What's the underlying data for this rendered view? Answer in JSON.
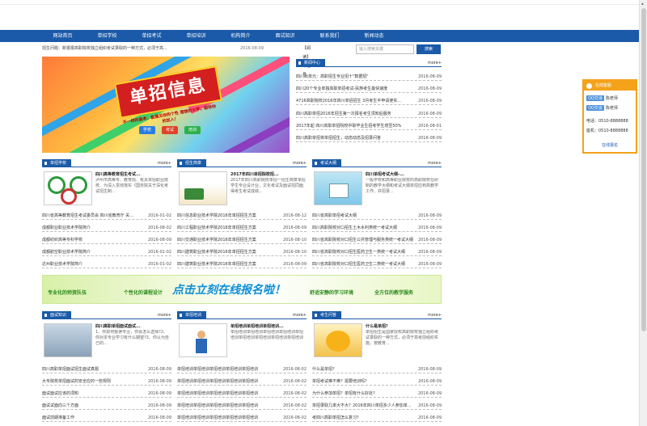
{
  "nav": [
    "网站首页",
    "单招学校",
    "单招考试",
    "单招培训",
    "机构简介",
    "面试知识",
    "联系我们",
    "新闻动态"
  ],
  "notice": {
    "text": "招生问题：新报报高职院校独立组织考试录取的一种方式，必须于高...",
    "date": "2016-08-09",
    "right": "【阅读】单招号"
  },
  "search": {
    "placeholder": "输入搜索关键",
    "button": "搜索"
  },
  "banner": {
    "headline": "单招信息",
    "sub": "不一样的高考，能遇见你的个性 理想的大学，期待你的加入！",
    "pills": [
      "学校",
      "考试",
      "培训"
    ]
  },
  "news_center": {
    "title": "新闻中心",
    "more": "more+",
    "rows": [
      {
        "t": "四川出单元：高职招生专业招十\"数据招\"",
        "d": "2016-08-09"
      },
      {
        "t": "四川20个专业单独高职单招考试-民族考生最快速度",
        "d": "2016-08-09"
      },
      {
        "t": "4716高职院校2016年四川单招招生 3月考生平申请使实...",
        "d": "2016-08-09"
      },
      {
        "t": "四川高职单招2016年招生第一次报名考生须知后服务",
        "d": "2016-08-09"
      },
      {
        "t": "2017年起 四川高职单招院校中职毕业生招考学生增至50%",
        "d": "2016-08-01"
      },
      {
        "t": "四川高职单招将单招招生，动态动态及招录问答",
        "d": "2016-08-09"
      }
    ]
  },
  "schools": {
    "title": "单招学校",
    "more": "more+",
    "feat_title": "四川高等教育招生考试...",
    "feat_desc": "泸州市高等专、教育局、有关单招职业院校、为深入贯彻落实《国务院关于深化考试招生制...",
    "rows": [
      {
        "t": "四川省高等教育招生考试委员会 四川省教育厅 关...",
        "d": "2016-01-02"
      },
      {
        "t": "成都职业职业技术学院简介",
        "d": "2016-08-02"
      },
      {
        "t": "成都纺织高等专科学校",
        "d": "2016-08-09"
      },
      {
        "t": "成都航空职业技术学院简介",
        "d": "2016-01-02"
      },
      {
        "t": "达州职业技术学院简介",
        "d": "2016-01-02"
      }
    ]
  },
  "admissions": {
    "title": "招生简章",
    "more": "more+",
    "feat_title": "2017年四川单招院校招...",
    "feat_desc": "2017年四川高职院校单招一招生简章单招学生专业设计业，文化考试及面试招同面得考生考试成绩...",
    "rows": [
      {
        "t": "四川信息职业技术学院2016年单招招生方案",
        "d": "2016-08-12"
      },
      {
        "t": "四川工程职业技术学院2016年单招招生方案",
        "d": "2016-08-09"
      },
      {
        "t": "四川交通职业技术学院2016年单招招生方案",
        "d": "2016-08-10"
      },
      {
        "t": "四川建筑职业技术学院2016年单招招生方案",
        "d": "2016-08-10"
      },
      {
        "t": "四川建筑职业技术学院2016年单招招生方案",
        "d": "2016-08-09"
      },
      {
        "t": "2017年四川省高职单招一招生简章",
        "d": "2016-08-09"
      }
    ]
  },
  "exam": {
    "title": "考试大纲",
    "more": "more+",
    "feat_title": "四川单招考试大纲-...",
    "feat_desc": "一般学校和高等职业院校的高职院校在研制的教学大纲和考试大纲单招应到高教学工作。并招录...",
    "rows": [
      {
        "t": "四川省高职单招考试大纲",
        "d": "2016-08-09"
      },
      {
        "t": "四川高职院校对口招生土木水利类统一考试大纲",
        "d": "2016-08-09"
      },
      {
        "t": "四川省高职院校对口招生公共管理与服务类统一考试大纲",
        "d": "2016-08-09"
      },
      {
        "t": "四川省高职院校对口招生医药卫生一类统一考试大纲",
        "d": "2016-08-09"
      },
      {
        "t": "四川省高职院校对口招生医药卫生二类统一考试大纲",
        "d": "2016-08-09"
      }
    ]
  },
  "wide": {
    "main": "点击立刻在线报名啦！",
    "w1": "专业化的师资队伍",
    "w2": "个性化的课程设计",
    "w3": "舒适安静的学习环境",
    "w4": "全方位的教学服务"
  },
  "interview": {
    "title": "面试知识",
    "more": "more+",
    "feat_title": "四川高职单招面试面试...",
    "feat_desc": "1、你如何报读专业，你会怎么选择?2、你对本专业学习有什么期望?3、你认为自己的...",
    "rows": [
      {
        "t": "四川高职单招面试招生面试真题",
        "d": "2016-08-09"
      },
      {
        "t": "大专院校单招面试的安全应的一些规则",
        "d": "2016-08-09"
      },
      {
        "t": "面试面试应该的须知",
        "d": "2016-08-09"
      },
      {
        "t": "面试试面向三个方面",
        "d": "2016-08-09"
      },
      {
        "t": "面试前期准备工作",
        "d": "2016-08-09"
      }
    ]
  },
  "training": {
    "title": "单招培训",
    "more": "more+",
    "feat_title": "单招培训单招培训单招培训...",
    "feat_desc": "单招培训单招培训单招培训单招培训单招培训单招培训单招培训单招培训单招培训",
    "rows": [
      {
        "t": "单招培训单招培训单招培训单招培训单招培训",
        "d": "2016-08-02"
      },
      {
        "t": "单招培训单招培训单招培训单招培训单招培训",
        "d": "2016-08-02"
      },
      {
        "t": "单招培训单招培训单招培训单招培训单招培训",
        "d": "2016-08-02"
      },
      {
        "t": "单招培训单招培训单招培训单招培训单招培训",
        "d": "2016-08-02"
      },
      {
        "t": "单招培训单招培训单招培训单招培训单招培训",
        "d": "2016-08-02"
      }
    ]
  },
  "faq": {
    "title": "考生问答",
    "more": "more+",
    "feat_title": "什么是单招？",
    "feat_desc": "单招招生是国家授权高职院校独立组织考试录取的一种方式，必须于高考前组织实施。按教育...",
    "rows": [
      {
        "t": "什么是单招？",
        "d": "2016-08-09"
      },
      {
        "t": "单招考试难不难？需要培训吗？",
        "d": "2016-08-09"
      },
      {
        "t": "为什么参加单招？单招有什么好处？",
        "d": "2016-08-09"
      },
      {
        "t": "单招录取几率大不大？2016年四川单招多少人参加单...",
        "d": "2016-08-09"
      },
      {
        "t": "考四川高职单招怎么复习？",
        "d": "2016-08-09"
      }
    ]
  },
  "kefu": {
    "title": "在线客服",
    "qq1": "QQ交谈",
    "n1": "陈老师",
    "qq2": "QQ交谈",
    "n2": "陈老师",
    "phone1": "电话：0510-8888888",
    "phone2": "座机：0510-8888888",
    "link": "在线报名"
  }
}
